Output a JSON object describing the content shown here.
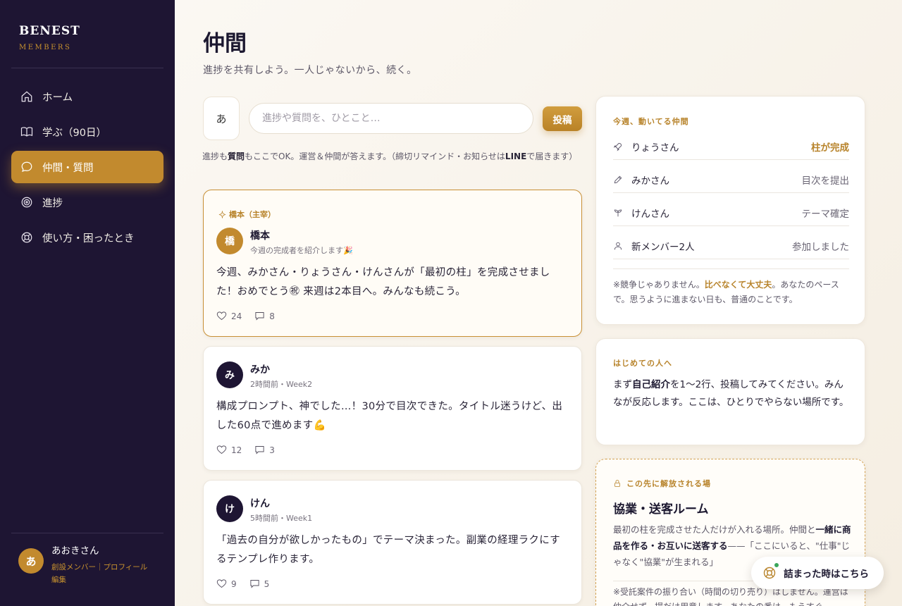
{
  "brand": {
    "name": "BENEST",
    "sub": "MEMBERS"
  },
  "nav": [
    {
      "label": "ホーム",
      "icon": "home-icon"
    },
    {
      "label": "学ぶ（90日）",
      "icon": "book-icon"
    },
    {
      "label": "仲間・質問",
      "icon": "chat-bubble-icon",
      "active": true
    },
    {
      "label": "進捗",
      "icon": "target-icon"
    },
    {
      "label": "使い方・困ったとき",
      "icon": "lifebuoy-icon"
    }
  ],
  "user": {
    "avatar": "あ",
    "name": "あおきさん",
    "role_link": "創設メンバー",
    "separator": "｜",
    "profile_link": "プロフィール",
    "edit_link": "編集"
  },
  "page": {
    "title": "仲間",
    "subtitle": "進捗を共有しよう。一人じゃないから、続く。"
  },
  "composer": {
    "avatar": "あ",
    "placeholder": "進捗や質問を、ひとこと…",
    "post_label": "投稿",
    "note_pre": "進捗も",
    "note_bold": "質問",
    "note_post": "もここでOK。運営＆仲間が答えます。（締切リマインド・お知らせは",
    "note_bold2": "LINE",
    "note_post2": "で届きます）"
  },
  "posts": [
    {
      "pinned": true,
      "tag": "橋本（主宰）",
      "avatar": "橋",
      "avatar_color": "#c28a2e",
      "name": "橋本",
      "meta": "今週の完成者を紹介します🎉",
      "body": "今週、みかさん・りょうさん・けんさんが「最初の柱」を完成させました！おめでとう㊗ 来週は2本目へ。みんなも続こう。",
      "likes": "24",
      "comments": "8"
    },
    {
      "avatar": "み",
      "avatar_color": "#1e1533",
      "name": "みか",
      "meta": "2時間前・Week2",
      "body": "構成プロンプト、神でした…！30分で目次できた。タイトル迷うけど、出した60点で進めます💪",
      "likes": "12",
      "comments": "3"
    },
    {
      "avatar": "け",
      "avatar_color": "#1e1533",
      "name": "けん",
      "meta": "5時間前・Week1",
      "body": "「過去の自分が欲しかったもの」でテーマ決まった。副業の経理ラクにするテンプレ作ります。",
      "likes": "9",
      "comments": "5"
    }
  ],
  "active_card": {
    "label": "今週、動いてる仲間",
    "rows": [
      {
        "icon": "rocket-icon",
        "name": "りょうさん",
        "status": "柱が完成",
        "highlight": true
      },
      {
        "icon": "pencil-icon",
        "name": "みかさん",
        "status": "目次を提出"
      },
      {
        "icon": "sprout-icon",
        "name": "けんさん",
        "status": "テーマ確定"
      },
      {
        "icon": "person-icon",
        "name": "新メンバー2人",
        "status": "参加しました"
      }
    ],
    "note_pre": "※競争じゃありません。",
    "note_bold": "比べなくて大丈夫",
    "note_post": "。あなたのペースで。思うように進まない日も、普通のことです。"
  },
  "intro_card": {
    "label": "はじめての人へ",
    "text_pre": "まず",
    "text_bold": "自己紹介",
    "text_post": "を1〜2行、投稿してみてください。みんなが反応します。ここは、ひとりでやらない場所です。"
  },
  "locked_card": {
    "label": "この先に解放される場",
    "title": "協業・送客ルーム",
    "text_pre": "最初の柱を完成させた人だけが入れる場所。仲間と",
    "text_bold": "一緒に商品を作る・お互いに送客する",
    "text_post": "——「ここにいると、\"仕事\"じゃなく\"協業\"が生まれる」",
    "note": "※受託案件の振り合い（時間の切り売り）はしません。運営は仲介せず、場だけ用意します。あなたの番は、もうすぐ。"
  },
  "help_button": {
    "label": "詰まった時はこちら"
  }
}
